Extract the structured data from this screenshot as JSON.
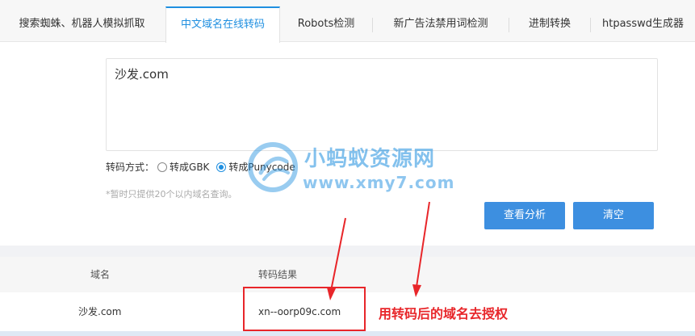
{
  "tabs": [
    {
      "label": "搜索蜘蛛、机器人模拟抓取"
    },
    {
      "label": "中文域名在线转码"
    },
    {
      "label": "Robots检测"
    },
    {
      "label": "新广告法禁用词检测"
    },
    {
      "label": "进制转换"
    },
    {
      "label": "htpasswd生成器"
    }
  ],
  "input": {
    "value": "沙发.com"
  },
  "mode": {
    "label": "转码方式：",
    "options": [
      {
        "label": "转成GBK",
        "checked": false
      },
      {
        "label": "转成Punycode",
        "checked": true
      }
    ]
  },
  "note": "*暂时只提供20个以内域名查询。",
  "buttons": {
    "analyze": "查看分析",
    "clear": "清空"
  },
  "table": {
    "headers": [
      "域名",
      "转码结果"
    ],
    "rows": [
      {
        "domain": "沙发.com",
        "result": "xn--oorp09c.com"
      }
    ]
  },
  "annotation": "用转码后的域名去授权",
  "watermark": {
    "title": "小蚂蚁资源网",
    "url": "www.xmy7.com"
  },
  "colors": {
    "accent": "#1f8fe0",
    "button": "#3d8fe0",
    "annotation": "#e8262a"
  }
}
